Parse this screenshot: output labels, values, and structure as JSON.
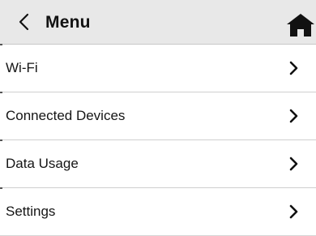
{
  "header": {
    "back_icon": "chevron-left-icon",
    "title": "Menu",
    "home_icon": "home-icon"
  },
  "menu": {
    "items": [
      {
        "label": "Wi-Fi",
        "icon": "chevron-right-icon"
      },
      {
        "label": "Connected Devices",
        "icon": "chevron-right-icon"
      },
      {
        "label": "Data Usage",
        "icon": "chevron-right-icon"
      },
      {
        "label": "Settings",
        "icon": "chevron-right-icon"
      }
    ]
  },
  "colors": {
    "header_background": "#e8e8e8",
    "text": "#111111",
    "divider": "#cfcfcf",
    "background": "#ffffff"
  }
}
